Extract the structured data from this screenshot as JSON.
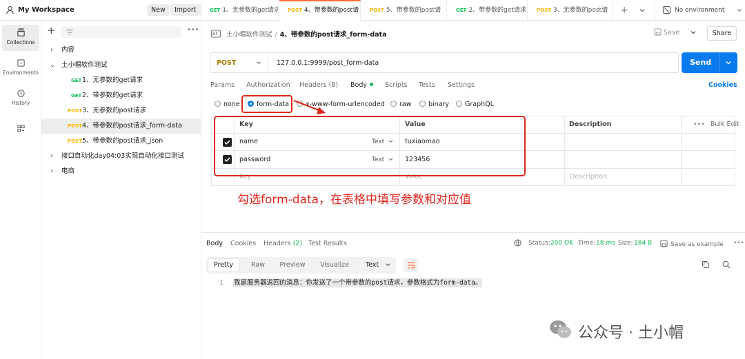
{
  "workspace": {
    "name": "My Workspace",
    "new_label": "New",
    "import_label": "Import"
  },
  "open_tabs": [
    {
      "method": "GET",
      "title": "1、无参数的get请求"
    },
    {
      "method": "POST",
      "title": "4、带参数的post请",
      "active": true
    },
    {
      "method": "POST",
      "title": "5、带参数的post请"
    },
    {
      "method": "GET",
      "title": "2、带参数的get请求"
    },
    {
      "method": "POST",
      "title": "3、无参数的post请"
    }
  ],
  "environment": {
    "label": "No environment"
  },
  "rail": [
    {
      "label": "Collections",
      "icon": "collections-icon",
      "active": true
    },
    {
      "label": "Environments",
      "icon": "environments-icon"
    },
    {
      "label": "History",
      "icon": "history-icon"
    },
    {
      "label": "",
      "icon": "apps-icon"
    }
  ],
  "sidebar": {
    "tree": [
      {
        "kind": "folder",
        "label": "内容",
        "expanded": false
      },
      {
        "kind": "folder",
        "label": "土小帽软件测试",
        "expanded": true
      },
      {
        "kind": "request",
        "method": "GET",
        "label": "1、无参数的get请求"
      },
      {
        "kind": "request",
        "method": "GET",
        "label": "2、带参数的get请求"
      },
      {
        "kind": "request",
        "method": "POST",
        "label": "3、无参数的post请求"
      },
      {
        "kind": "request",
        "method": "POST",
        "label": "4、带参数的post请求_form-data",
        "selected": true
      },
      {
        "kind": "request",
        "method": "POST",
        "label": "5、带参数的post请求_json"
      },
      {
        "kind": "folder",
        "label": "接口自动化day04:03实现自动化接口测试",
        "expanded": false
      },
      {
        "kind": "folder",
        "label": "电商",
        "expanded": false
      }
    ]
  },
  "breadcrumb": {
    "collection": "土小帽软件测试",
    "separator": "/",
    "request": "4、带参数的post请求_form-data"
  },
  "actions": {
    "save_label": "Save",
    "share_label": "Share",
    "send_label": "Send"
  },
  "request": {
    "method": "POST",
    "url": "127.0.0.1:9999/post_form-data"
  },
  "request_tabs": [
    {
      "label": "Params"
    },
    {
      "label": "Authorization"
    },
    {
      "label": "Headers",
      "count": "(8)"
    },
    {
      "label": "Body",
      "active": true,
      "dot": true
    },
    {
      "label": "Scripts"
    },
    {
      "label": "Tests"
    },
    {
      "label": "Settings"
    }
  ],
  "cookies_label": "Cookies",
  "body_types": [
    {
      "label": "none"
    },
    {
      "label": "form-data",
      "selected": true
    },
    {
      "label": "x-www-form-urlencoded"
    },
    {
      "label": "raw"
    },
    {
      "label": "binary"
    },
    {
      "label": "GraphQL"
    }
  ],
  "params_table": {
    "headers": {
      "key": "Key",
      "value": "Value",
      "description": "Description",
      "bulk_edit": "Bulk Edit"
    },
    "rows": [
      {
        "checked": true,
        "key": "name",
        "type": "Text",
        "value": "tuxiaomao"
      },
      {
        "checked": true,
        "key": "password",
        "type": "Text",
        "value": "123456"
      }
    ],
    "placeholder": {
      "key": "Key",
      "value": "Value",
      "description": "Description"
    }
  },
  "annotation": "勾选form-data，在表格中填写参数和对应值",
  "response": {
    "tabs": [
      {
        "label": "Body",
        "active": true
      },
      {
        "label": "Cookies"
      },
      {
        "label": "Headers",
        "count": "(2)"
      },
      {
        "label": "Test Results"
      }
    ],
    "status_label": "Status:",
    "status_value": "200 OK",
    "time_label": "Time:",
    "time_value": "18 ms",
    "size_label": "Size:",
    "size_value": "184 B",
    "save_example": "Save as example",
    "views": [
      "Pretty",
      "Raw",
      "Preview",
      "Visualize"
    ],
    "format": "Text",
    "line_number": "1",
    "line_text": "我是服务器返回的消息：你发送了一个带参数的post请求，参数格式为form-data。"
  },
  "watermark": "公众号 · 土小帽",
  "colors": {
    "accent": "#097bed",
    "highlight": "#e0261d",
    "post": "#ffb400",
    "get": "#0cbb52",
    "tab_active": "#ff6c37"
  }
}
